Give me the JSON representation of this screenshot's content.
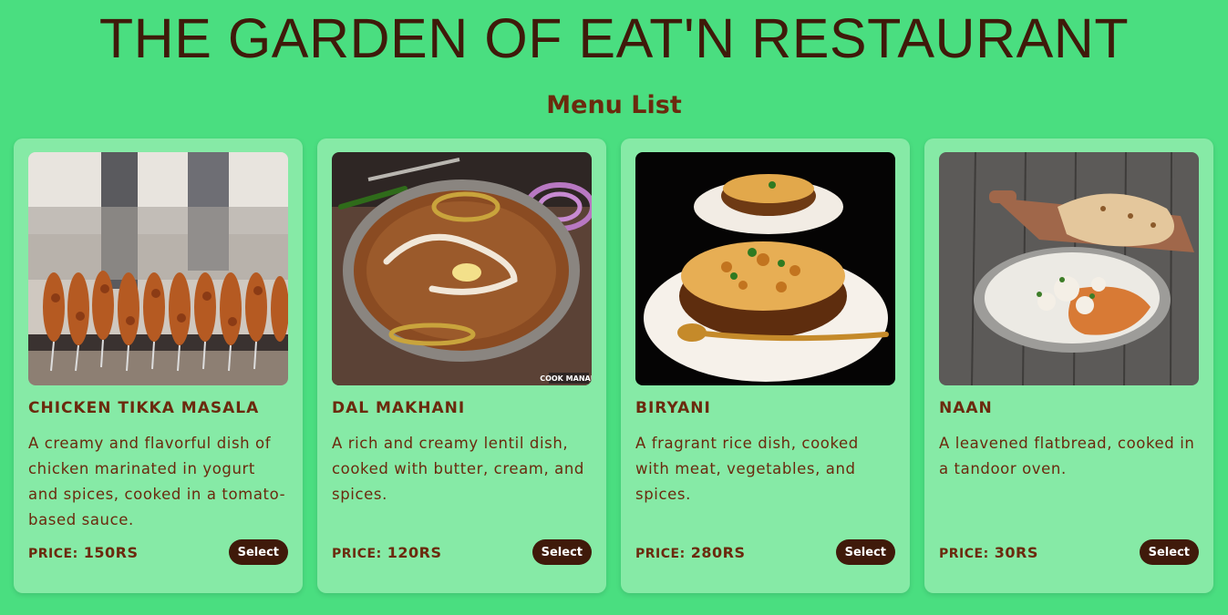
{
  "header": {
    "title": "THE GARDEN OF EAT'N RESTAURANT",
    "subtitle": "Menu List"
  },
  "menu": {
    "price_label": "PRICE:",
    "select_label": "Select",
    "items": [
      {
        "name": "Chicken Tikka Masala",
        "description": "A creamy and flavorful dish of chicken marinated in yogurt and spices, cooked in a tomato-based sauce.",
        "price": "150RS",
        "image": "chicken-skewers-grill"
      },
      {
        "name": "Dal Makhani",
        "description": "A rich and creamy lentil dish, cooked with butter, cream, and spices.",
        "price": "120RS",
        "image": "dal-makhani-bowl"
      },
      {
        "name": "Biryani",
        "description": "A fragrant rice dish, cooked with meat, vegetables, and spices.",
        "price": "280RS",
        "image": "biryani-bowls"
      },
      {
        "name": "Naan",
        "description": "A leavened flatbread, cooked in a tandoor oven.",
        "price": "30RS",
        "image": "naan-with-curry"
      }
    ]
  },
  "image_watermark": "COOK MANALI",
  "colors": {
    "page_background": "#4ade80",
    "card_background": "#86eaa6",
    "text_brown": "#6b2a0e",
    "button_background": "#3f1a0a"
  }
}
